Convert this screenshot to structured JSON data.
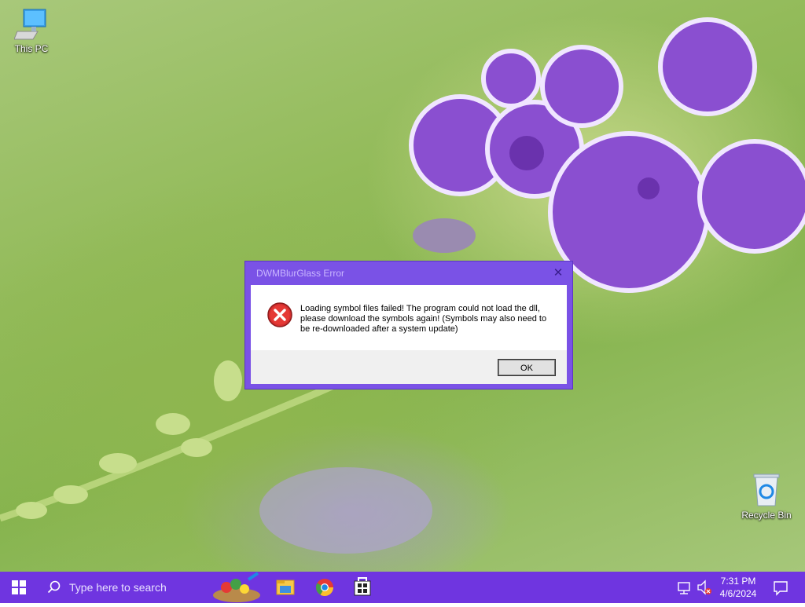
{
  "desktop": {
    "icons": [
      {
        "label": "This PC"
      },
      {
        "label": "Recycle Bin"
      }
    ]
  },
  "dialog": {
    "title": "DWMBlurGlass Error",
    "close_glyph": "✕",
    "message": "Loading symbol files failed! The program could not load the dll, please download the symbols again! (Symbols may also need to be re-downloaded after a system update)",
    "ok_label": "OK",
    "icon": "error-icon",
    "accent": "#7a52e6"
  },
  "taskbar": {
    "color": "#6f35e0",
    "search_placeholder": "Type here to search",
    "apps": [
      "paint-app-icon",
      "file-explorer-icon",
      "chrome-icon",
      "store-icon"
    ],
    "clock_time": "7:31 PM",
    "clock_date": "4/6/2024"
  }
}
